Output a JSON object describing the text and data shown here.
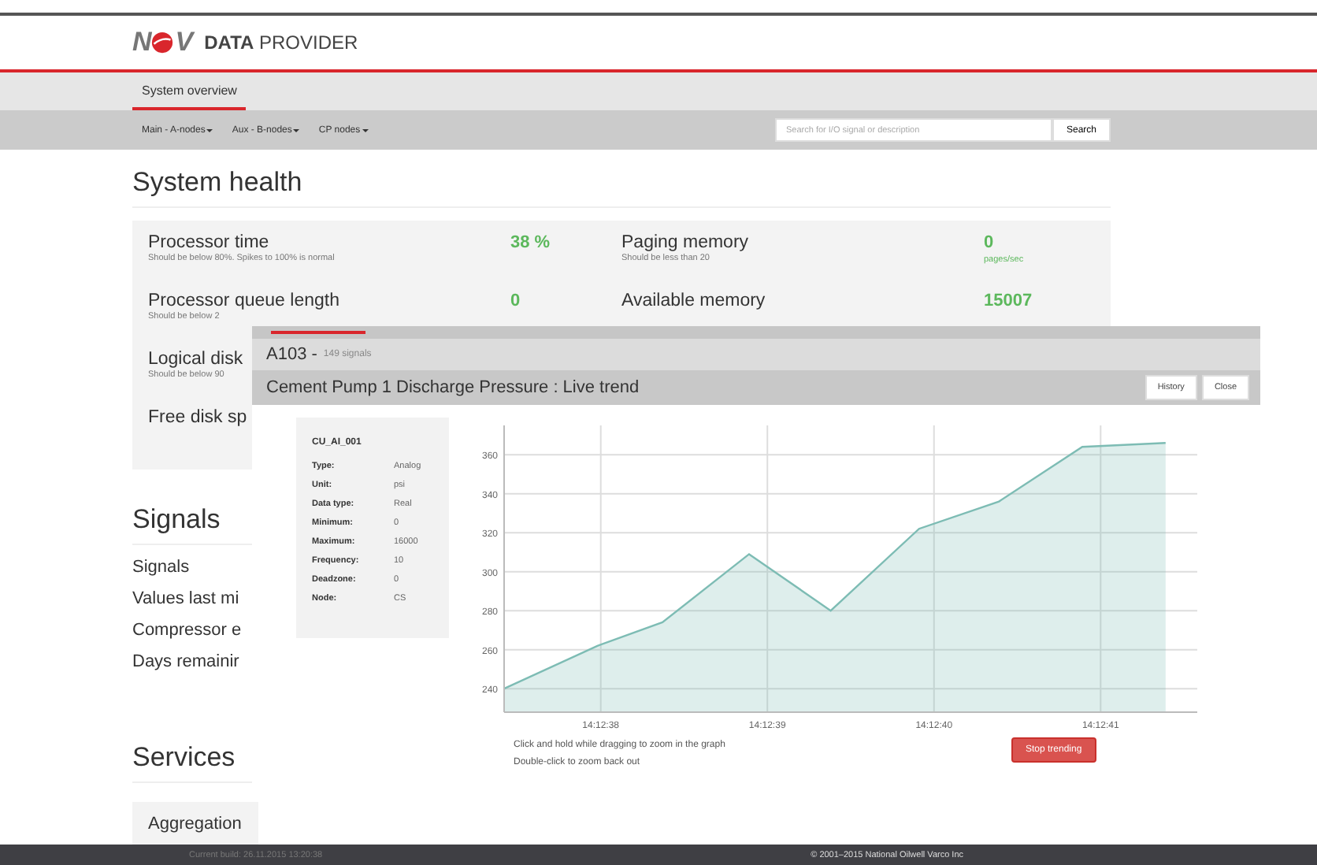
{
  "header": {
    "logo_left": "N",
    "logo_right": "V",
    "title_bold": "DATA",
    "title_rest": "PROVIDER"
  },
  "tabs": [
    {
      "label": "System overview",
      "selected": true
    }
  ],
  "nav": {
    "menus": [
      "Main - A-nodes",
      "Aux - B-nodes",
      "CP nodes"
    ],
    "search": {
      "placeholder": "Search for I/O signal or description"
    },
    "search_button": "Search"
  },
  "system_health": {
    "heading": "System health",
    "rows": [
      {
        "left": {
          "label": "Processor time",
          "hint": "Should be below 80%. Spikes to 100% is normal",
          "value": "38 %"
        },
        "right": {
          "label": "Paging memory",
          "hint": "Should be less than 20",
          "value": "0",
          "unit": "pages/sec"
        }
      },
      {
        "left": {
          "label": "Processor queue length",
          "hint": "Should be below 2",
          "value": "0"
        },
        "right": {
          "label": "Available memory",
          "value": "15007"
        }
      },
      {
        "left": {
          "label": "Logical disk",
          "hint": "Should be below 90"
        }
      },
      {
        "left": {
          "label": "Free disk sp"
        }
      }
    ]
  },
  "signals": {
    "heading": "Signals",
    "items": [
      "Signals",
      "Values last mi",
      "Compressor e",
      "Days remainir"
    ]
  },
  "services": {
    "heading": "Services",
    "items": [
      "Aggregation"
    ]
  },
  "modal": {
    "node": "A103 -",
    "signal_count": "149 signals",
    "title": "Cement Pump 1 Discharge Pressure : Live trend",
    "buttons": [
      "History",
      "Close"
    ],
    "info": {
      "tag": "CU_AI_001",
      "fields": [
        {
          "label": "Type:",
          "value": "Analog"
        },
        {
          "label": "Unit:",
          "value": "psi"
        },
        {
          "label": "Data type:",
          "value": "Real"
        },
        {
          "label": "Minimum:",
          "value": "0"
        },
        {
          "label": "Maximum:",
          "value": "16000"
        },
        {
          "label": "Frequency:",
          "value": "10"
        },
        {
          "label": "Deadzone:",
          "value": "0"
        },
        {
          "label": "Node:",
          "value": "CS"
        }
      ]
    },
    "chart_data": {
      "type": "area",
      "grid": true,
      "x": [
        51157.42,
        51157.98,
        51158.37,
        51158.89,
        51159.38,
        51159.91,
        51160.39,
        51160.89,
        51161.39
      ],
      "series": [
        {
          "color": "#7dbcb4",
          "values": [
            240,
            262,
            274,
            309,
            280,
            322,
            336,
            364,
            366
          ]
        }
      ],
      "xlim": [
        51157.42,
        51161.58
      ],
      "ylim": [
        228,
        375
      ],
      "xticks": [
        {
          "value": 51158,
          "label": "14:12:38"
        },
        {
          "value": 51159,
          "label": "14:12:39"
        },
        {
          "value": 51160,
          "label": "14:12:40"
        },
        {
          "value": 51161,
          "label": "14:12:41"
        }
      ],
      "yticks": [
        {
          "value": 240,
          "label": "240"
        },
        {
          "value": 260,
          "label": "260"
        },
        {
          "value": 280,
          "label": "280"
        },
        {
          "value": 300,
          "label": "300"
        },
        {
          "value": 320,
          "label": "320"
        },
        {
          "value": 340,
          "label": "340"
        },
        {
          "value": 360,
          "label": "360"
        }
      ]
    },
    "hints": [
      "Click and hold while dragging to zoom in the graph",
      "Double-click to zoom back out"
    ],
    "stop_button": "Stop trending"
  },
  "footer": {
    "build": "Current build: 26.11.2015 13:20:38",
    "copyright": "© 2001–2015 National Oilwell Varco Inc"
  }
}
